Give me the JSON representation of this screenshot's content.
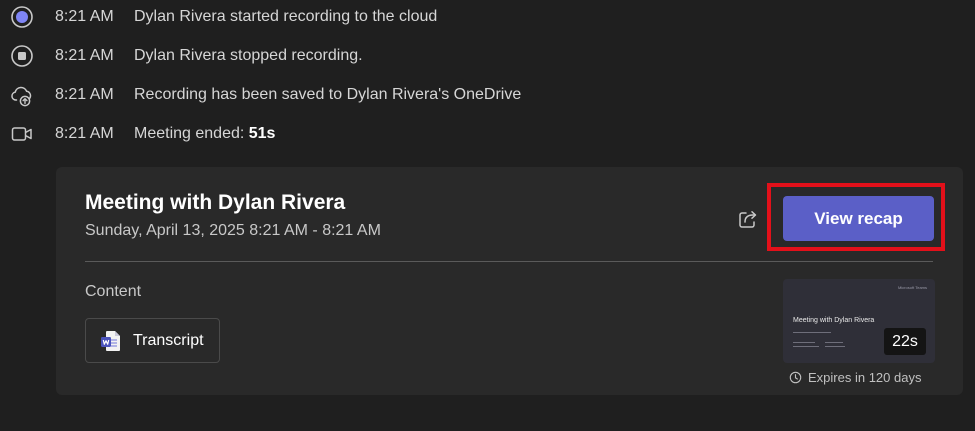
{
  "events": [
    {
      "icon": "recording-dot-icon",
      "time": "8:21 AM",
      "text": "Dylan Rivera started recording to the cloud",
      "bold": ""
    },
    {
      "icon": "stop-circle-icon",
      "time": "8:21 AM",
      "text": "Dylan Rivera stopped recording.",
      "bold": ""
    },
    {
      "icon": "cloud-upload-icon",
      "time": "8:21 AM",
      "text": "Recording has been saved to Dylan Rivera's OneDrive",
      "bold": ""
    },
    {
      "icon": "video-camera-icon",
      "time": "8:21 AM",
      "text": "Meeting ended: ",
      "bold": "51s"
    }
  ],
  "card": {
    "title": "Meeting with Dylan Rivera",
    "subtitle": "Sunday, April 13, 2025 8:21 AM - 8:21 AM",
    "share_icon": "share-icon",
    "recap_label": "View recap",
    "content_label": "Content",
    "transcript_label": "Transcript",
    "thumbnail": {
      "corner_text": "Microsoft Teams",
      "title": "Meeting with Dylan Rivera",
      "duration": "22s"
    },
    "expires": "Expires in 120 days"
  },
  "colors": {
    "background": "#1f1f1f",
    "card": "#292929",
    "accent": "#5b5fc7",
    "highlight": "#e3101a",
    "recording": "#7f85f5"
  }
}
